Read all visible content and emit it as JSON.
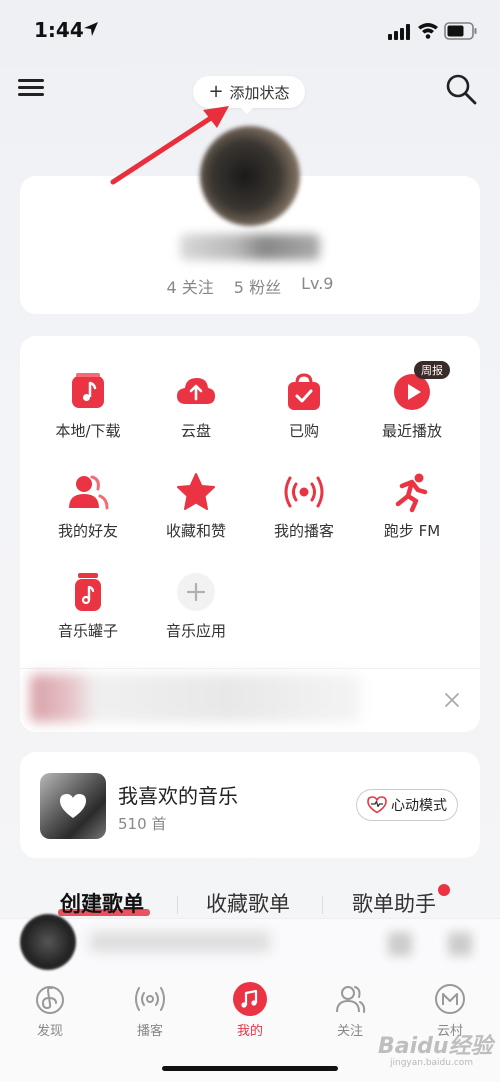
{
  "status": {
    "time": "1:44"
  },
  "header": {
    "add_status_label": "添加状态",
    "add_status_plus": "+"
  },
  "profile": {
    "following": "4 关注",
    "followers": "5 粉丝",
    "level": "Lv.9"
  },
  "grid": {
    "items": [
      {
        "label": "本地/下载",
        "icon": "music-note-icon"
      },
      {
        "label": "云盘",
        "icon": "cloud-upload-icon"
      },
      {
        "label": "已购",
        "icon": "bag-check-icon"
      },
      {
        "label": "最近播放",
        "icon": "play-circle-icon"
      },
      {
        "label": "我的好友",
        "icon": "friends-icon"
      },
      {
        "label": "收藏和赞",
        "icon": "star-icon"
      },
      {
        "label": "我的播客",
        "icon": "podcast-icon"
      },
      {
        "label": "跑步 FM",
        "icon": "running-icon"
      },
      {
        "label": "音乐罐子",
        "icon": "music-jar-icon"
      },
      {
        "label": "音乐应用",
        "icon": "plus-circle-icon"
      }
    ],
    "weekly_badge": "周报"
  },
  "liked": {
    "title": "我喜欢的音乐",
    "count": "510 首",
    "mode_button": "心动模式"
  },
  "tabs": {
    "create": "创建歌单",
    "collect": "收藏歌单",
    "helper": "歌单助手"
  },
  "nav": [
    {
      "label": "发现",
      "icon": "netease-logo-icon"
    },
    {
      "label": "播客",
      "icon": "podcast-icon"
    },
    {
      "label": "我的",
      "icon": "music-icon"
    },
    {
      "label": "关注",
      "icon": "people-icon"
    },
    {
      "label": "云村",
      "icon": "village-icon"
    }
  ],
  "watermark": {
    "text": "Baidu经验",
    "sub": "jingyan.baidu.com"
  },
  "colors": {
    "accent": "#ea3443",
    "background": "#f3f4f7"
  }
}
